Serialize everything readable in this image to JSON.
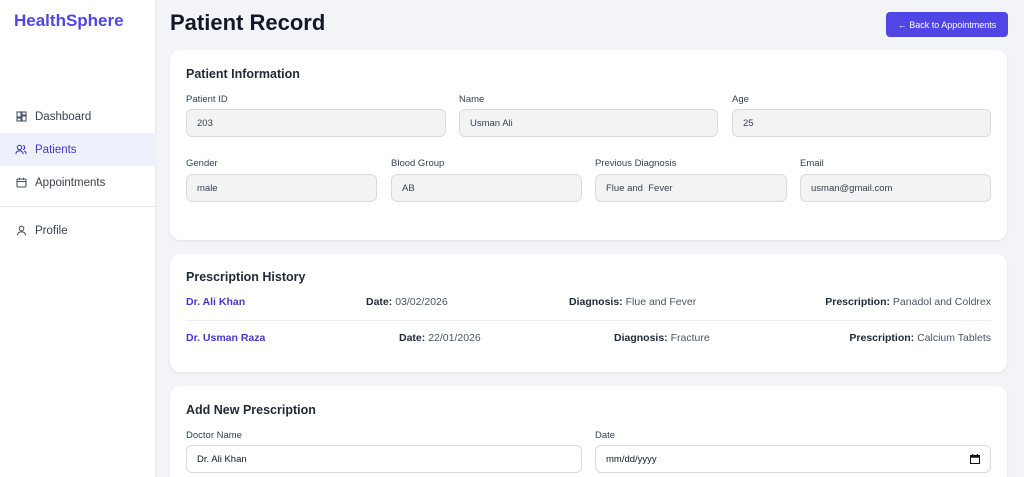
{
  "app": {
    "brand": "HealthSphere"
  },
  "sidebar": {
    "items": [
      {
        "label": "Dashboard",
        "icon": "dashboard-icon"
      },
      {
        "label": "Patients",
        "icon": "users-icon",
        "active": true
      },
      {
        "label": "Appointments",
        "icon": "calendar-icon"
      },
      {
        "label": "Profile",
        "icon": "user-icon"
      }
    ]
  },
  "header": {
    "title": "Patient Record",
    "back_label": "← Back to Appointments"
  },
  "patient_info": {
    "title": "Patient Information",
    "fields": {
      "patient_id": {
        "label": "Patient ID",
        "value": "203"
      },
      "name": {
        "label": "Name",
        "value": "Usman Ali"
      },
      "age": {
        "label": "Age",
        "value": "25"
      },
      "gender": {
        "label": "Gender",
        "value": "male"
      },
      "blood_group": {
        "label": "Blood Group",
        "value": "AB"
      },
      "previous_diagnosis": {
        "label": "Previous Diagnosis",
        "value": "Flue and  Fever"
      },
      "email": {
        "label": "Email",
        "value": "usman@gmail.com"
      }
    }
  },
  "prescription_history": {
    "title": "Prescription History",
    "date_label": "Date:",
    "diagnosis_label": "Diagnosis:",
    "prescription_label": "Prescription:",
    "rows": [
      {
        "doctor": "Dr. Ali Khan",
        "date": "03/02/2026",
        "diagnosis": "Flue and Fever",
        "prescription": "Panadol and Coldrex"
      },
      {
        "doctor": "Dr. Usman Raza",
        "date": "22/01/2026",
        "diagnosis": "Fracture",
        "prescription": "Calcium Tablets"
      }
    ]
  },
  "add_prescription": {
    "title": "Add New Prescription",
    "doctor_label": "Doctor Name",
    "doctor_value": "Dr. Ali Khan",
    "date_label": "Date",
    "date_placeholder": "mm/dd/yyyy"
  },
  "colors": {
    "accent": "#4f46e5",
    "background": "#f3f4f8"
  }
}
